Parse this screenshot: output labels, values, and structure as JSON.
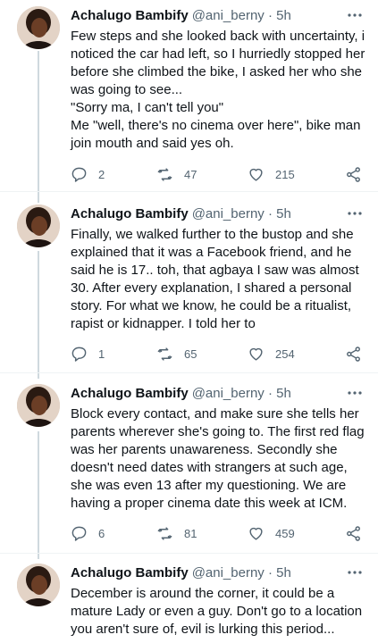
{
  "tweets": [
    {
      "name": "Achalugo Bambify",
      "handle": "@ani_berny · 5h",
      "text": "Few steps and she looked back with uncertainty, i noticed the car had left, so I hurriedly stopped her before she climbed the bike, I asked her who she was going to see...\n\"Sorry ma, I can't tell you\"\nMe \"well, there's no cinema over here\", bike man join mouth and said yes oh.",
      "replies": "2",
      "retweets": "47",
      "likes": "215"
    },
    {
      "name": "Achalugo Bambify",
      "handle": "@ani_berny · 5h",
      "text": "Finally, we walked further to the bustop and she explained that it was a Facebook friend, and he said he is 17.. toh, that agbaya I saw was almost 30. After every explanation, I shared a personal story. For what we know, he could be a ritualist, rapist or kidnapper. I told her to",
      "replies": "1",
      "retweets": "65",
      "likes": "254"
    },
    {
      "name": "Achalugo Bambify",
      "handle": "@ani_berny · 5h",
      "text": "Block every contact, and make sure she tells her parents wherever she's going to. The first red flag was her parents unawareness. Secondly she doesn't need dates with strangers at such age, she was even 13 after my questioning. We are having a proper cinema date this week at ICM.",
      "replies": "6",
      "retweets": "81",
      "likes": "459"
    },
    {
      "name": "Achalugo Bambify",
      "handle": "@ani_berny · 5h",
      "text": "December is around the corner, it could be a mature Lady or even a guy. Don't go to a location you aren't sure of, evil is lurking this period...",
      "replies": "",
      "retweets": "",
      "likes": ""
    }
  ],
  "icons": {
    "reply": "reply-icon",
    "retweet": "retweet-icon",
    "like": "heart-icon",
    "share": "share-icon",
    "more": "more-icon"
  },
  "colors": {
    "text": "#0f1419",
    "muted": "#536471",
    "thread_line": "#cfd9de",
    "divider": "#eff3f4"
  }
}
